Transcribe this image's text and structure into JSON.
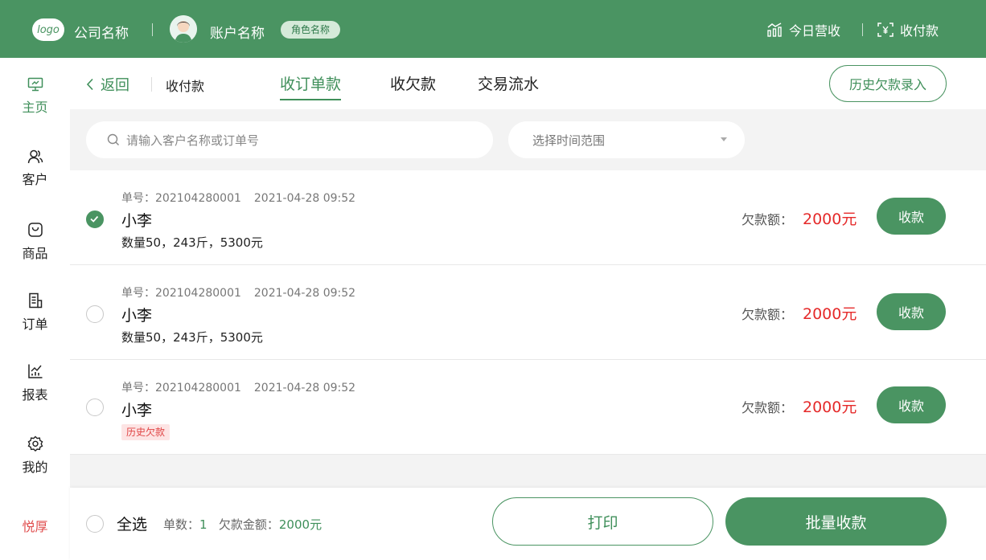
{
  "header": {
    "logo_text": "logo",
    "company": "公司名称",
    "account": "账户名称",
    "role": "角色名称",
    "revenue_label": "今日营收",
    "payment_label": "收付款",
    "accent_color": "#4a9462"
  },
  "sidebar": {
    "items": [
      {
        "label": "主页",
        "icon": "monitor-icon",
        "active": true
      },
      {
        "label": "客户",
        "icon": "users-icon"
      },
      {
        "label": "商品",
        "icon": "bag-icon"
      },
      {
        "label": "订单",
        "icon": "document-icon"
      },
      {
        "label": "报表",
        "icon": "chart-icon"
      },
      {
        "label": "我的",
        "icon": "gear-icon"
      }
    ],
    "brand": "悦厚"
  },
  "subheader": {
    "back_label": "返回",
    "breadcrumb": "收付款",
    "tabs": [
      {
        "label": "收订单款",
        "active": true
      },
      {
        "label": "收欠款"
      },
      {
        "label": "交易流水"
      }
    ],
    "history_button": "历史欠款录入"
  },
  "filters": {
    "search_placeholder": "请输入客户名称或订单号",
    "date_placeholder": "选择时间范围"
  },
  "orders": [
    {
      "order_no": "单号：202104280001",
      "time": "2021-04-28 09:52",
      "customer": "小李",
      "detail": "数量50，243斤，5300元",
      "owed_label": "欠款额：",
      "owed": "2000元",
      "action": "收款",
      "checked": true
    },
    {
      "order_no": "单号：202104280001",
      "time": "2021-04-28 09:52",
      "customer": "小李",
      "detail": "数量50，243斤，5300元",
      "owed_label": "欠款额：",
      "owed": "2000元",
      "action": "收款",
      "checked": false
    },
    {
      "order_no": "单号：202104280001",
      "time": "2021-04-28 09:52",
      "customer": "小李",
      "tag": "历史欠款",
      "owed_label": "欠款额：",
      "owed": "2000元",
      "action": "收款",
      "checked": false
    }
  ],
  "footer": {
    "select_all": "全选",
    "count_label": "单数：",
    "count": "1",
    "amount_label": "欠款金额：",
    "amount": "2000元",
    "print_button": "打印",
    "batch_button": "批量收款"
  }
}
